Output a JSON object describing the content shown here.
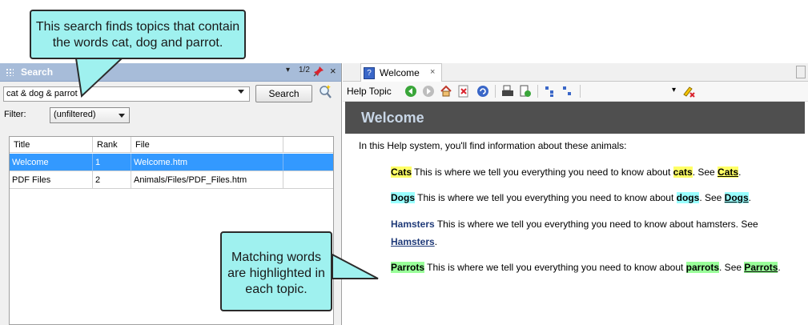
{
  "search_pane": {
    "title": "Search",
    "controls": [
      "▾",
      "1/2",
      "×"
    ],
    "query": "cat & dog & parrot",
    "search_button": "Search",
    "filter_label": "Filter:",
    "filter_value": "(unfiltered)",
    "columns": [
      "Title",
      "Rank",
      "File"
    ],
    "rows": [
      {
        "title": "Welcome",
        "rank": "1",
        "file": "Welcome.htm"
      },
      {
        "title": "PDF Files",
        "rank": "2",
        "file": "Animals/Files/PDF_Files.htm"
      }
    ]
  },
  "help_pane": {
    "tab_label": "Welcome",
    "tab_close": "×",
    "toolbar_label": "Help Topic",
    "banner_title": "Welcome",
    "intro": "In this Help system, you'll find information about these animals:",
    "items": [
      {
        "name": "Cats",
        "text": " This is where we tell you everything you need to know about ",
        "word": "cats",
        "see": ". See ",
        "link": "Cats",
        "end": "."
      },
      {
        "name": "Dogs",
        "text": " This is where we tell you everything you need to know about ",
        "word": "dogs",
        "see": ". See ",
        "link": "Dogs",
        "end": "."
      },
      {
        "name": "Hamsters",
        "text": " This is where we tell you everything you need to know about hamsters. See ",
        "link": "Hamsters",
        "end": "."
      },
      {
        "name": "Parrots",
        "text": " This is where we tell you everything you need to know about ",
        "word": "parrots",
        "see": ". See ",
        "link": "Parrots",
        "end": "."
      }
    ]
  },
  "callouts": {
    "top": "This search finds topics that contain the words cat, dog and parrot.",
    "bottom": "Matching words are highlighted in each topic."
  },
  "colors": {
    "highlight_cat": "#ffff66",
    "highlight_dog": "#99ffff",
    "highlight_parrot": "#99ff99",
    "callout_fill": "#9ff1ef",
    "selection": "#3399ff"
  }
}
